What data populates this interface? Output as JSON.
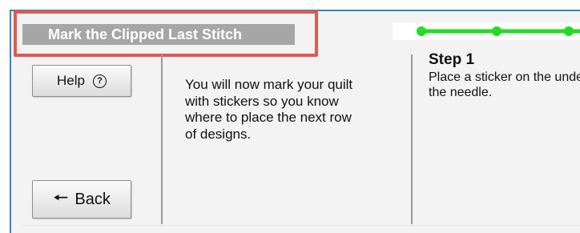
{
  "header": {
    "title": "Mark the Clipped Last Stitch"
  },
  "progress": {
    "color": "#22dd22",
    "highlight_color": "#e05a4d"
  },
  "sidebar": {
    "help_label": "Help",
    "help_icon": "question-circle-icon",
    "back_label": "Back",
    "back_icon": "left-arrow-icon"
  },
  "intro": {
    "text": "You will now mark your quilt with stickers so you know where to place the next row of designs."
  },
  "step": {
    "title": "Step 1",
    "text": "Place a sticker on the under the needle."
  }
}
